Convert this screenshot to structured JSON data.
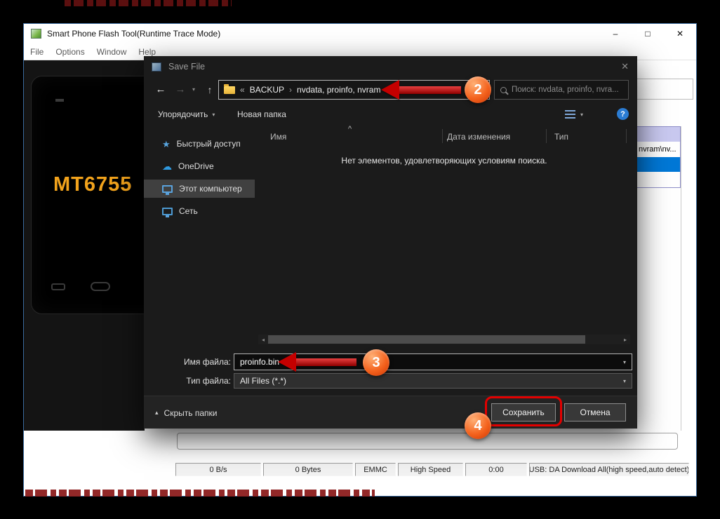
{
  "main_window": {
    "title": "Smart Phone Flash Tool(Runtime Trace Mode)",
    "menu": [
      "File",
      "Options",
      "Window",
      "Help"
    ],
    "controls": {
      "minimize": "–",
      "maximize": "□",
      "close": "✕"
    },
    "phone_label": "MT6755",
    "right_list_text": "nvram\\nv...",
    "status_cells": [
      "0 B/s",
      "0 Bytes",
      "EMMC",
      "High Speed",
      "0:00",
      "USB: DA Download All(high speed,auto detect)"
    ]
  },
  "dialog": {
    "title": "Save File",
    "close_glyph": "✕",
    "nav": {
      "back": "←",
      "forward": "→",
      "dropdown": "▾",
      "up": "↑"
    },
    "breadcrumb": {
      "overflow": "«",
      "root": "BACKUP",
      "separator": "›",
      "current": "nvdata, proinfo, nvram"
    },
    "search_placeholder": "Поиск: nvdata, proinfo, nvra...",
    "toolbar": {
      "organize": "Упорядочить",
      "organize_caret": "▾",
      "new_folder": "Новая папка",
      "view_caret": "▾",
      "help": "?"
    },
    "sidebar": [
      {
        "label": "Быстрый доступ"
      },
      {
        "label": "OneDrive"
      },
      {
        "label": "Этот компьютер"
      },
      {
        "label": "Сеть"
      }
    ],
    "columns": {
      "name": "Имя",
      "sort_caret": "^",
      "date": "Дата изменения",
      "type": "Тип"
    },
    "empty_message": "Нет элементов, удовлетворяющих условиям поиска.",
    "scrollbar": {
      "left": "◂",
      "right": "▸"
    },
    "filename_label": "Имя файла:",
    "filename_value": "proinfo.bin",
    "filename_caret": "▾",
    "filetype_label": "Тип файла:",
    "filetype_value": "All Files (*.*)",
    "filetype_caret": "▾",
    "hide_folders_caret": "▴",
    "hide_folders": "Скрыть папки",
    "save_label": "Сохранить",
    "cancel_label": "Отмена"
  },
  "annotations": {
    "step2": "2",
    "step3": "3",
    "step4": "4"
  },
  "colors": {
    "annotation_red": "#e30000",
    "badge_orange": "#f4631e",
    "selection_blue": "#0078d7",
    "phone_brand_orange": "#f2a31c",
    "row_lavender": "#c9c9f0",
    "help_blue": "#2b7cd3"
  }
}
